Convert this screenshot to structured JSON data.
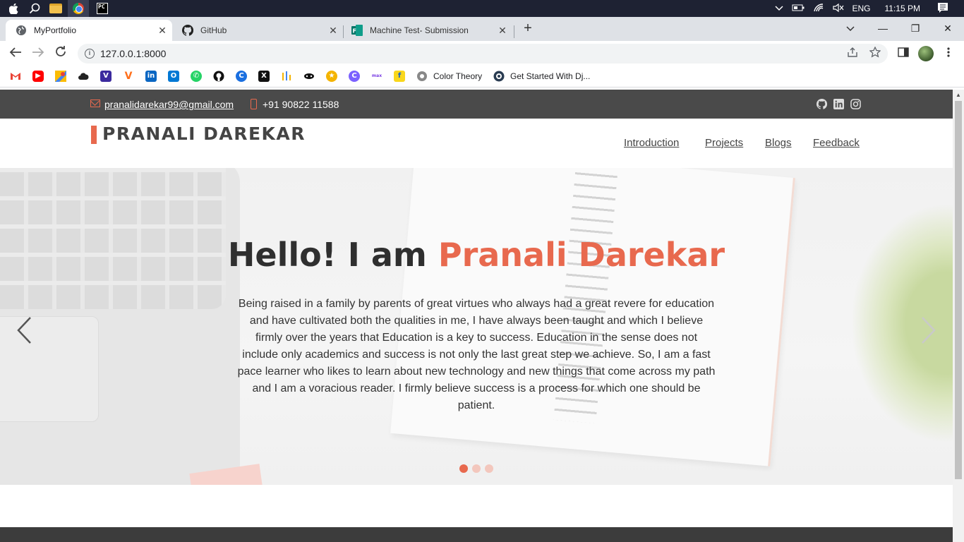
{
  "os": {
    "language": "ENG",
    "time": "11:15 PM"
  },
  "tabs": [
    {
      "title": "MyPortfolio",
      "active": true
    },
    {
      "title": "GitHub",
      "active": false
    },
    {
      "title": "Machine Test- Submission",
      "active": false
    }
  ],
  "address_bar": {
    "url": "127.0.0.1:8000"
  },
  "bookmarks": {
    "named": [
      "Color Theory",
      "Get Started With Dj..."
    ]
  },
  "contact": {
    "email": "pranalidarekar99@gmail.com",
    "phone": "+91 90822 11588"
  },
  "site": {
    "brand": "PRANALI DAREKAR",
    "nav": [
      "Introduction",
      "Projects",
      "Blogs",
      "Feedback"
    ]
  },
  "hero": {
    "title_prefix": "Hello! I am ",
    "title_name": "Pranali Darekar",
    "text": "Being raised in a family by parents of great virtues who always had a great revere for education and have cultivated both the qualities in me, I have always been taught and which I believe firmly over the years that Education is a key to success. Education in the sense does not include only academics and success is not only the last great step we achieve. So, I am a fast pace learner who likes to learn about new technology and new things that come across my path and I am a voracious reader. I firmly believe success is a process for which one should be patient.",
    "active_slide": 1,
    "slide_count": 3
  },
  "colors": {
    "accent": "#e8694e",
    "contact_bar": "#4a4a4a"
  }
}
